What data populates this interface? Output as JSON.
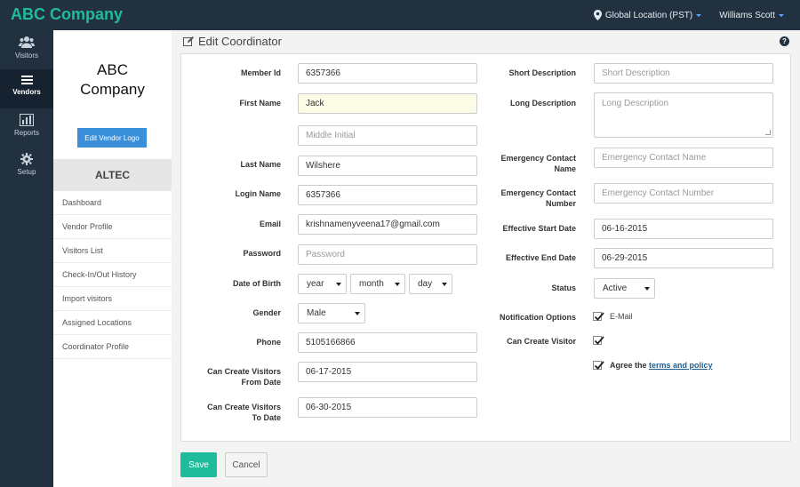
{
  "app": {
    "brand": "ABC Company"
  },
  "header": {
    "location": "Global Location (PST)",
    "user": "Williams Scott"
  },
  "rail": [
    {
      "label": "Visitors",
      "icon": "users-icon"
    },
    {
      "label": "Vendors",
      "icon": "list-icon"
    },
    {
      "label": "Reports",
      "icon": "bar-chart-icon"
    },
    {
      "label": "Setup",
      "icon": "gear-icon"
    }
  ],
  "vendor": {
    "company_line1": "ABC",
    "company_line2": "Company",
    "edit_logo": "Edit Vendor Logo",
    "name": "ALTEC",
    "menu": [
      "Dashboard",
      "Vendor Profile",
      "Visitors List",
      "Check-In/Out History",
      "Import visitors",
      "Assigned Locations",
      "Coordinator Profile"
    ]
  },
  "page": {
    "title": "Edit Coordinator",
    "help": "?"
  },
  "form": {
    "member_id": {
      "label": "Member Id",
      "value": "6357366"
    },
    "first_name": {
      "label": "First Name",
      "value": "Jack"
    },
    "middle_initial": {
      "placeholder": "Middle Initial"
    },
    "last_name": {
      "label": "Last Name",
      "value": "Wilshere"
    },
    "login_name": {
      "label": "Login Name",
      "value": "6357366"
    },
    "email": {
      "label": "Email",
      "value": "krishnamenyveena17@gmail.com"
    },
    "password": {
      "label": "Password",
      "placeholder": "Password"
    },
    "dob": {
      "label": "Date of Birth",
      "year": "year",
      "month": "month",
      "day": "day"
    },
    "gender": {
      "label": "Gender",
      "value": "Male"
    },
    "phone": {
      "label": "Phone",
      "value": "5105166866"
    },
    "from_date": {
      "label1": "Can Create Visitors",
      "label2": "From Date",
      "value": "06-17-2015"
    },
    "to_date": {
      "label1": "Can Create Visitors",
      "label2": "To Date",
      "value": "06-30-2015"
    },
    "short_desc": {
      "label": "Short Description",
      "placeholder": "Short Description"
    },
    "long_desc": {
      "label": "Long Description",
      "placeholder": "Long Description"
    },
    "emerg_name": {
      "label1": "Emergency Contact",
      "label2": "Name",
      "placeholder": "Emergency Contact Name"
    },
    "emerg_number": {
      "label1": "Emergency Contact",
      "label2": "Number",
      "placeholder": "Emergency Contact Number"
    },
    "start_date": {
      "label": "Effective Start Date",
      "value": "06-16-2015"
    },
    "end_date": {
      "label": "Effective End Date",
      "value": "06-29-2015"
    },
    "status": {
      "label": "Status",
      "value": "Active"
    },
    "notifications": {
      "label": "Notification Options",
      "option": "E-Mail"
    },
    "can_create": {
      "label": "Can Create Visitor"
    },
    "agree": {
      "text": "Agree the",
      "link": "terms and policy"
    }
  },
  "actions": {
    "save": "Save",
    "cancel": "Cancel"
  },
  "colors": {
    "topbar": "#22313f",
    "accent": "#1fbc9c",
    "button_blue": "#3a8fd9"
  }
}
